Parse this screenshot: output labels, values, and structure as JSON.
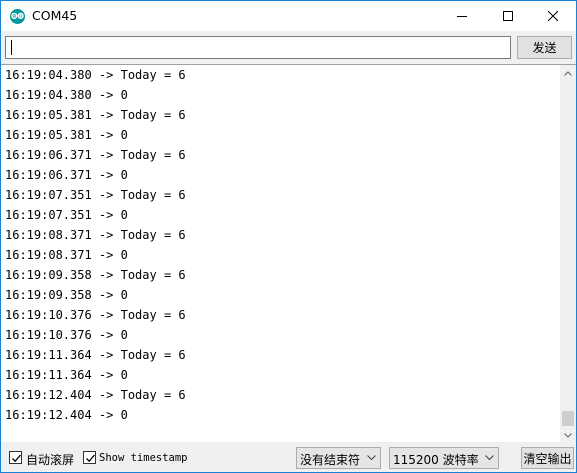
{
  "window": {
    "title": "COM45",
    "accent": "#1883d7",
    "app_icon_color": "#00979c"
  },
  "send_row": {
    "input_value": "",
    "send_label": "发送"
  },
  "output": {
    "lines": [
      "16:19:04.380 -> Today = 6",
      "16:19:04.380 -> 0",
      "16:19:05.381 -> Today = 6",
      "16:19:05.381 -> 0",
      "16:19:06.371 -> Today = 6",
      "16:19:06.371 -> 0",
      "16:19:07.351 -> Today = 6",
      "16:19:07.351 -> 0",
      "16:19:08.371 -> Today = 6",
      "16:19:08.371 -> 0",
      "16:19:09.358 -> Today = 6",
      "16:19:09.358 -> 0",
      "16:19:10.376 -> Today = 6",
      "16:19:10.376 -> 0",
      "16:19:11.364 -> Today = 6",
      "16:19:11.364 -> 0",
      "16:19:12.404 -> Today = 6",
      "16:19:12.404 -> 0"
    ]
  },
  "bottom": {
    "autoscroll_label": "自动滚屏",
    "autoscroll_checked": true,
    "timestamp_label": "Show timestamp",
    "timestamp_checked": true,
    "line_ending_value": "没有结束符",
    "baud_value": "115200 波特率",
    "clear_label": "清空输出"
  }
}
